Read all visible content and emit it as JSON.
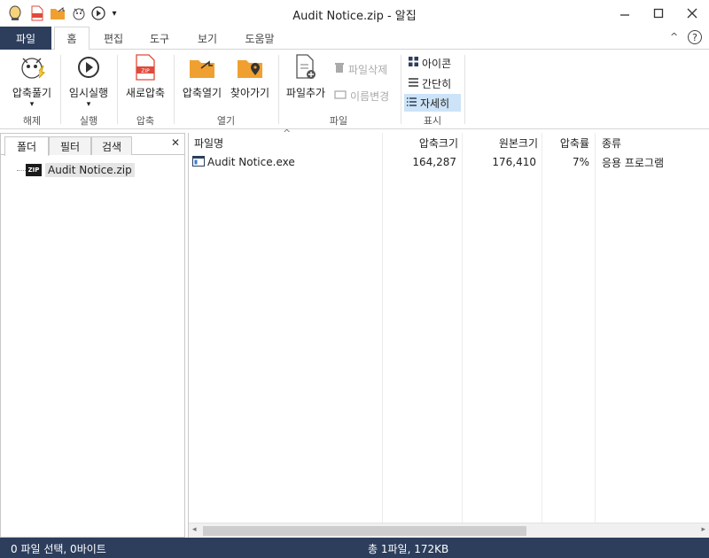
{
  "window": {
    "title": "Audit Notice.zip - 알집",
    "controls": [
      "minimize",
      "maximize",
      "close"
    ]
  },
  "quick_access": {
    "icons": [
      "alzip-logo-icon",
      "zip-file-icon",
      "open-folder-icon",
      "mascot-icon",
      "play-icon",
      "dropdown-caret-icon"
    ]
  },
  "tabs": {
    "file": "파일",
    "items": [
      "홈",
      "편집",
      "도구",
      "보기",
      "도움말"
    ],
    "active_index": 0
  },
  "ribbon": {
    "extract": "압축풀기",
    "extract_caret": "▾",
    "run": "임시실행",
    "run_caret": "▾",
    "new_zip": "새로압축",
    "open_zip": "압축열기",
    "locate": "찾아가기",
    "add_file": "파일추가",
    "delete_file": "파일삭제",
    "rename": "이름변경",
    "view_icon": "아이콘",
    "view_simple": "간단히",
    "view_detail": "자세히",
    "groups": {
      "extract": "해제",
      "run": "실행",
      "zip": "압축",
      "open": "열기",
      "file": "파일",
      "view": "표시"
    }
  },
  "left_pane": {
    "tabs": [
      "폴더",
      "필터",
      "검색"
    ],
    "active_tab": 0,
    "close": "✕",
    "tree_item": "Audit Notice.zip",
    "tree_icon_label": "ZIP"
  },
  "file_list": {
    "columns": [
      "파일명",
      "압축크기",
      "원본크기",
      "압축률",
      "종류"
    ],
    "sort_arrow": "^",
    "rows": [
      {
        "name": "Audit Notice.exe",
        "compressed": "164,287",
        "original": "176,410",
        "ratio": "7%",
        "type": "응용 프로그램"
      }
    ]
  },
  "status": {
    "left": "0 파일 선택,  0바이트",
    "center": "총 1파일,  172KB"
  },
  "colors": {
    "navy": "#2c3e5c",
    "folder_orange": "#f0a030",
    "zip_red": "#e04a3a",
    "selection": "#cde3f7"
  }
}
